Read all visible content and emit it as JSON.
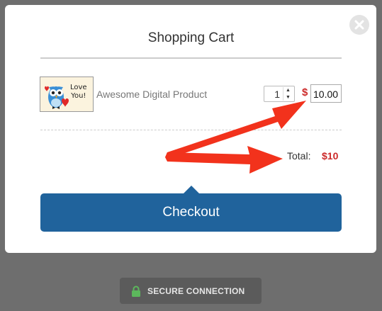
{
  "cart": {
    "title": "Shopping Cart",
    "close_icon": "close-icon",
    "item": {
      "thumbnail_text": "Love\nYou!",
      "thumbnail_icon": "owl-heart-image",
      "name": "Awesome Digital Product",
      "quantity": "1",
      "currency_symbol": "$",
      "price": "10.00"
    },
    "total_label": "Total:",
    "total_value": "$10",
    "checkout_label": "Checkout"
  },
  "footer": {
    "secure_label": "SECURE CONNECTION",
    "lock_icon": "lock-icon"
  },
  "colors": {
    "accent": "#20639c",
    "price_red": "#cc2a2a",
    "arrow_red": "#f2321c",
    "lock_green": "#5cb85c",
    "overlay": "#6e6e6e"
  }
}
